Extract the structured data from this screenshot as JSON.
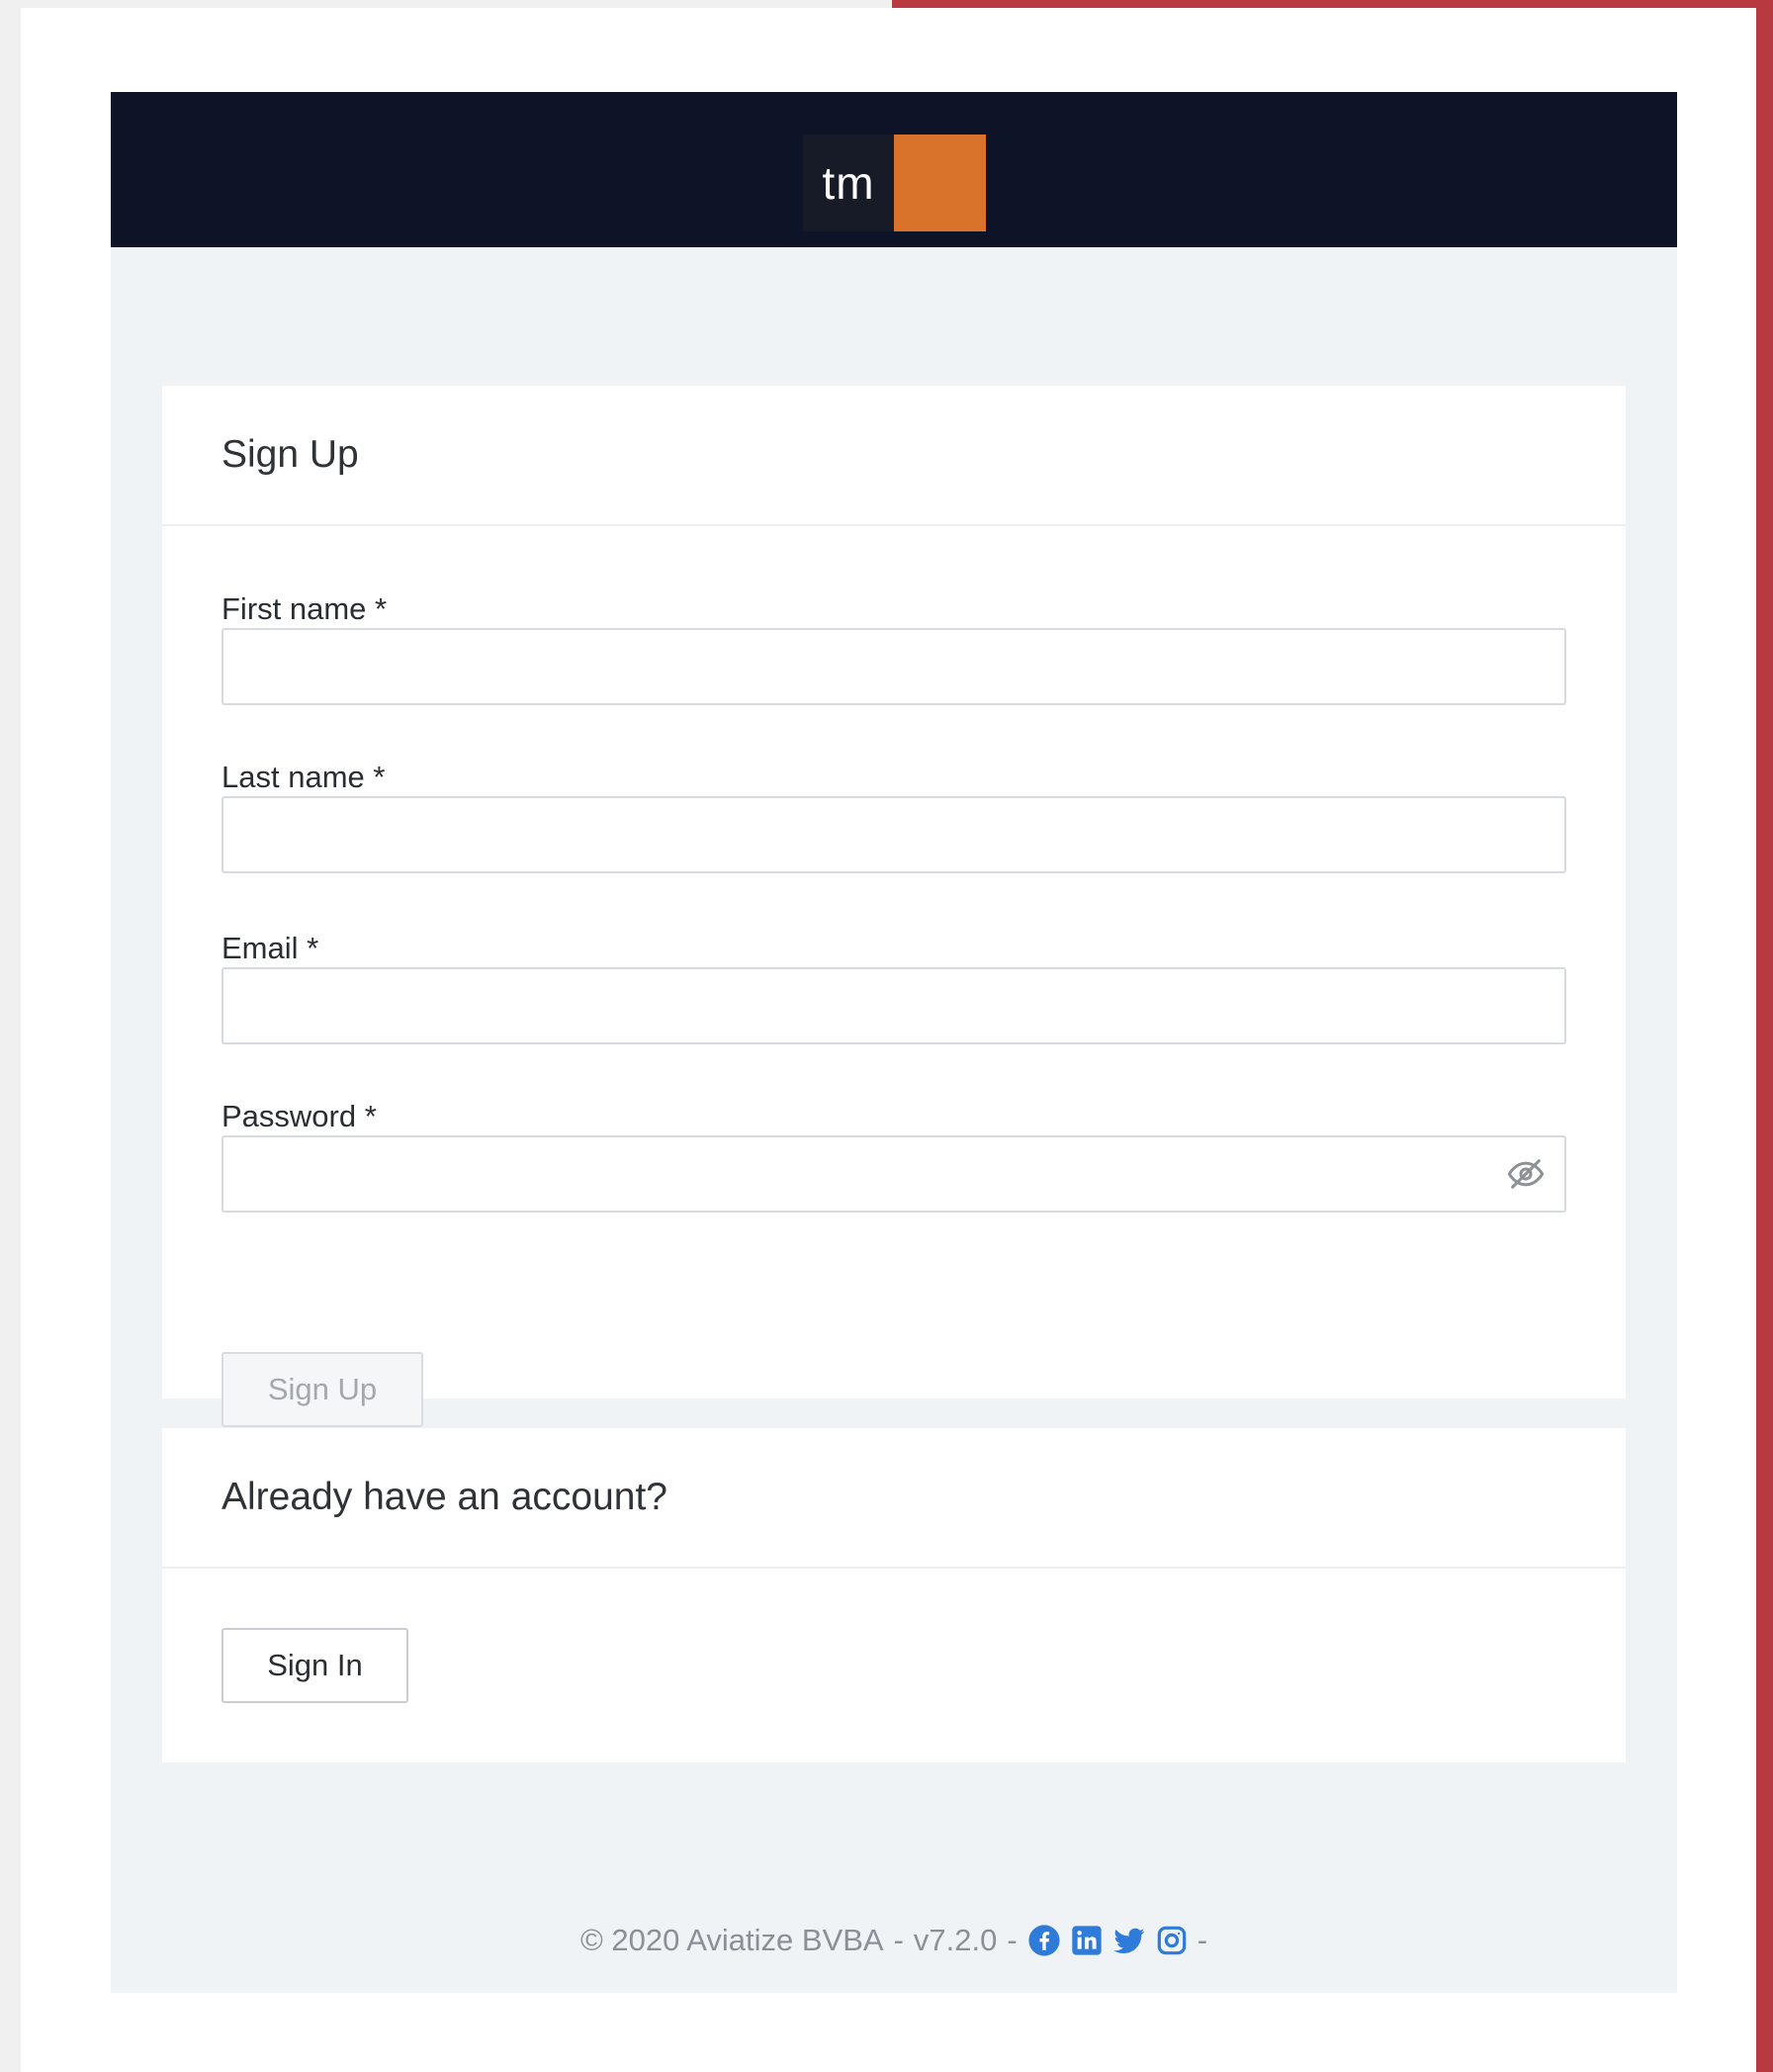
{
  "logo": {
    "text": "tm",
    "colors": {
      "dark": "#161b27",
      "accent": "#d9732c"
    }
  },
  "signup_card": {
    "title": "Sign Up",
    "fields": [
      {
        "label": "First name *",
        "value": "",
        "placeholder": ""
      },
      {
        "label": "Last name *",
        "value": "",
        "placeholder": ""
      },
      {
        "label": "Email *",
        "value": "",
        "placeholder": ""
      },
      {
        "label": "Password *",
        "value": "",
        "placeholder": "",
        "icon": "eye-slash-icon"
      }
    ],
    "submit_label": "Sign Up"
  },
  "signin_card": {
    "title": "Already have an account?",
    "button_label": "Sign In"
  },
  "footer": {
    "copyright": "© 2020 Aviatize BVBA",
    "separator": "-",
    "version": "v7.2.0",
    "social_icons": [
      "facebook-icon",
      "linkedin-icon",
      "twitter-icon",
      "instagram-icon"
    ],
    "social_color": "#2f7bd9"
  },
  "page_colors": {
    "header_bg": "#0d1427",
    "page_bg": "#f0f3f6",
    "window_accent": "#b8393f"
  }
}
